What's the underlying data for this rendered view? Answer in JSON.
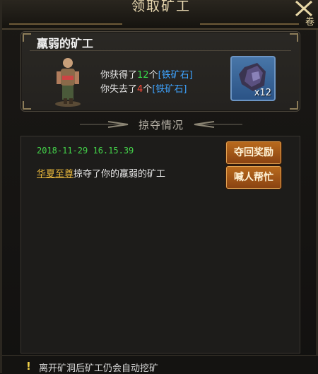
{
  "window": {
    "title": "领取矿工",
    "close_label": "卷"
  },
  "top_panel": {
    "name": "羸弱的矿工",
    "gain_prefix": "你获得了",
    "gain_count": "12",
    "gain_unit": "个",
    "gain_item": "[铁矿石]",
    "loss_prefix": "你失去了",
    "loss_count": "4",
    "loss_unit": "个",
    "loss_item": "[铁矿石]",
    "reward_quantity": "x12"
  },
  "section": {
    "title": "掠夺情况"
  },
  "log": {
    "timestamp": "2018-11-29 16.15.39",
    "player": "华夏至尊",
    "action": "掠夺了你的",
    "target": "羸弱的矿工"
  },
  "buttons": {
    "recover": "夺回奖励",
    "help": "喊人帮忙"
  },
  "footer": {
    "icon": "!",
    "tip": "离开矿洞后矿工仍会自动挖矿"
  },
  "colors": {
    "accent_orange": "#b86a1d",
    "gain_green": "#37d84a",
    "loss_red": "#ff4a3a",
    "item_blue": "#3ea3ff",
    "player_gold": "#e8b73c"
  },
  "icons": {
    "close": "close-icon",
    "miner": "miner-portrait",
    "ore": "iron-ore-icon",
    "tip": "warning-icon"
  }
}
